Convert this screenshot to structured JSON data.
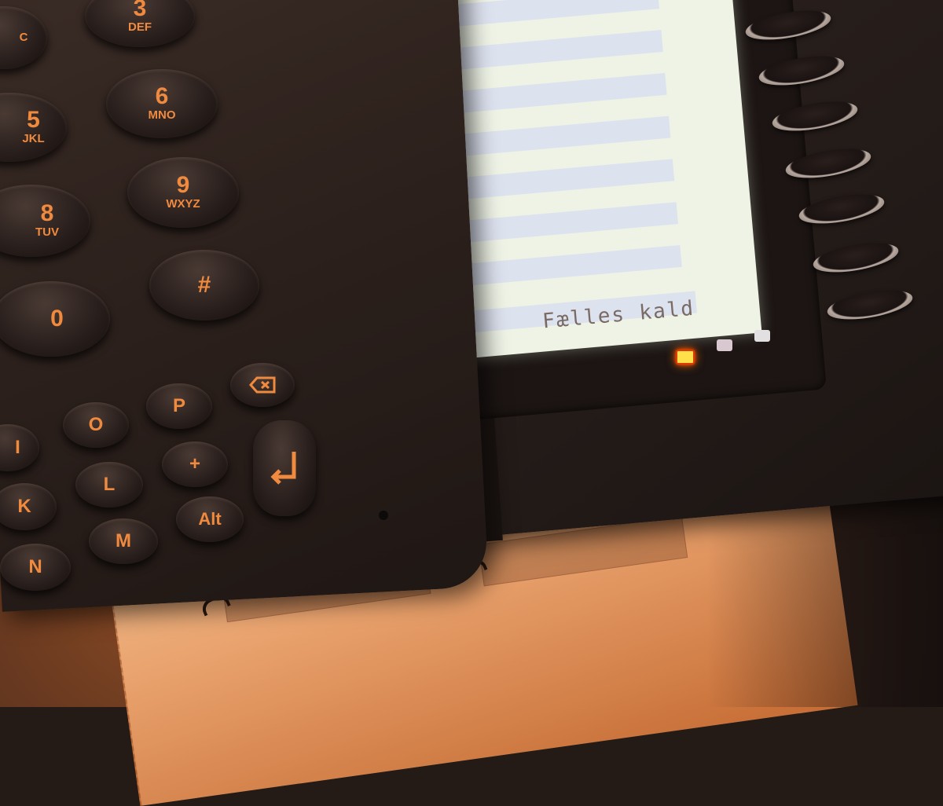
{
  "screen": {
    "status_text": "Fælles kald",
    "rows": 8
  },
  "keypad": {
    "keys": [
      {
        "digit": "3",
        "letters": "DEF"
      },
      {
        "digit": "6",
        "letters": "MNO"
      },
      {
        "digit": "5",
        "letters": "JKL"
      },
      {
        "digit": "9",
        "letters": "WXYZ"
      },
      {
        "digit": "8",
        "letters": "TUV"
      },
      {
        "digit": "#",
        "letters": ""
      },
      {
        "digit": "0",
        "letters": ""
      },
      {
        "digit": "C",
        "letters": ""
      }
    ],
    "letter_keys": [
      "O",
      "P",
      "L",
      "+",
      "K",
      "M",
      "Alt",
      "N",
      "I"
    ],
    "enter_icon": "return-arrow-icon",
    "backspace_icon": "backspace-icon"
  },
  "leds": {
    "active_color": "#ffe04a",
    "inactive_color": "#d9c8cf"
  },
  "accent_color": "#f08a3e"
}
